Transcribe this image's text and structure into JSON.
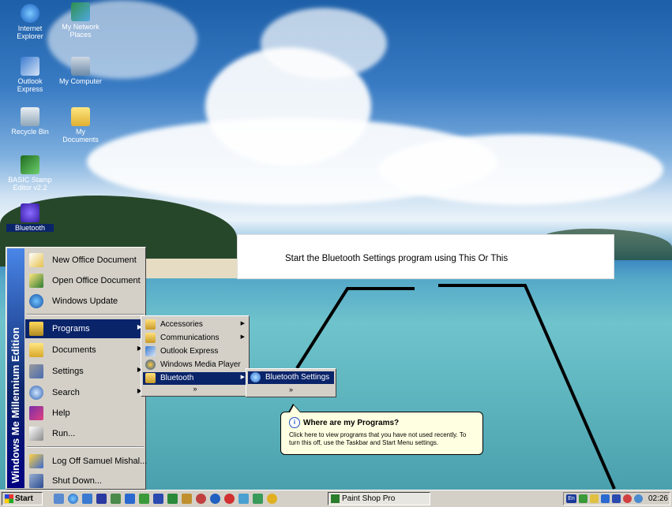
{
  "desktop": {
    "icons": [
      {
        "label": "Internet Explorer",
        "icon": "internet-explorer-icon"
      },
      {
        "label": "My Network Places",
        "icon": "network-places-icon"
      },
      {
        "label": "Outlook Express",
        "icon": "outlook-express-icon"
      },
      {
        "label": "My Computer",
        "icon": "my-computer-icon"
      },
      {
        "label": "Recycle Bin",
        "icon": "recycle-bin-icon"
      },
      {
        "label": "My Documents",
        "icon": "my-documents-icon"
      },
      {
        "label": "BASIC Stamp Editor v2.2",
        "icon": "basic-stamp-icon"
      },
      {
        "label": "Bluetooth",
        "icon": "bluetooth-icon"
      }
    ]
  },
  "callout": {
    "text": "Start the Bluetooth Settings program using This Or This"
  },
  "start_menu": {
    "banner": "Windows Me Millennium Edition",
    "top_items": [
      {
        "label": "New Office Document",
        "icon": "new-office-document-icon"
      },
      {
        "label": "Open Office Document",
        "icon": "open-office-document-icon"
      },
      {
        "label": "Windows Update",
        "icon": "windows-update-icon"
      }
    ],
    "items": [
      {
        "label": "Programs",
        "icon": "programs-icon"
      },
      {
        "label": "Documents",
        "icon": "documents-icon"
      },
      {
        "label": "Settings",
        "icon": "settings-icon"
      },
      {
        "label": "Search",
        "icon": "search-icon"
      },
      {
        "label": "Help",
        "icon": "help-icon"
      },
      {
        "label": "Run...",
        "icon": "run-icon"
      }
    ],
    "bottom_items": [
      {
        "label": "Log Off Samuel Mishal...",
        "icon": "log-off-icon"
      },
      {
        "label": "Shut Down...",
        "icon": "shut-down-icon"
      }
    ]
  },
  "programs_menu": {
    "items": [
      {
        "label": "Accessories",
        "icon": "folder-icon"
      },
      {
        "label": "Communications",
        "icon": "folder-icon"
      },
      {
        "label": "Outlook Express",
        "icon": "outlook-express-icon"
      },
      {
        "label": "Windows Media Player",
        "icon": "media-player-icon"
      },
      {
        "label": "Bluetooth",
        "icon": "folder-icon"
      }
    ],
    "expand": "»"
  },
  "bluetooth_menu": {
    "items": [
      {
        "label": "Bluetooth Settings",
        "icon": "bluetooth-settings-icon"
      }
    ],
    "expand": "»"
  },
  "tooltip": {
    "title": "Where are my Programs?",
    "body": "Click here to view programs that you have not used recently. To turn this off, use the Taskbar and Start Menu settings.",
    "icon": "info-icon"
  },
  "taskbar": {
    "start_label": "Start",
    "task_label": "Paint Shop Pro",
    "clock": "02:26",
    "language": "En"
  },
  "colors": {
    "selection": "#0a246a",
    "face": "#d4d0c8",
    "tooltip": "#ffffe1"
  }
}
